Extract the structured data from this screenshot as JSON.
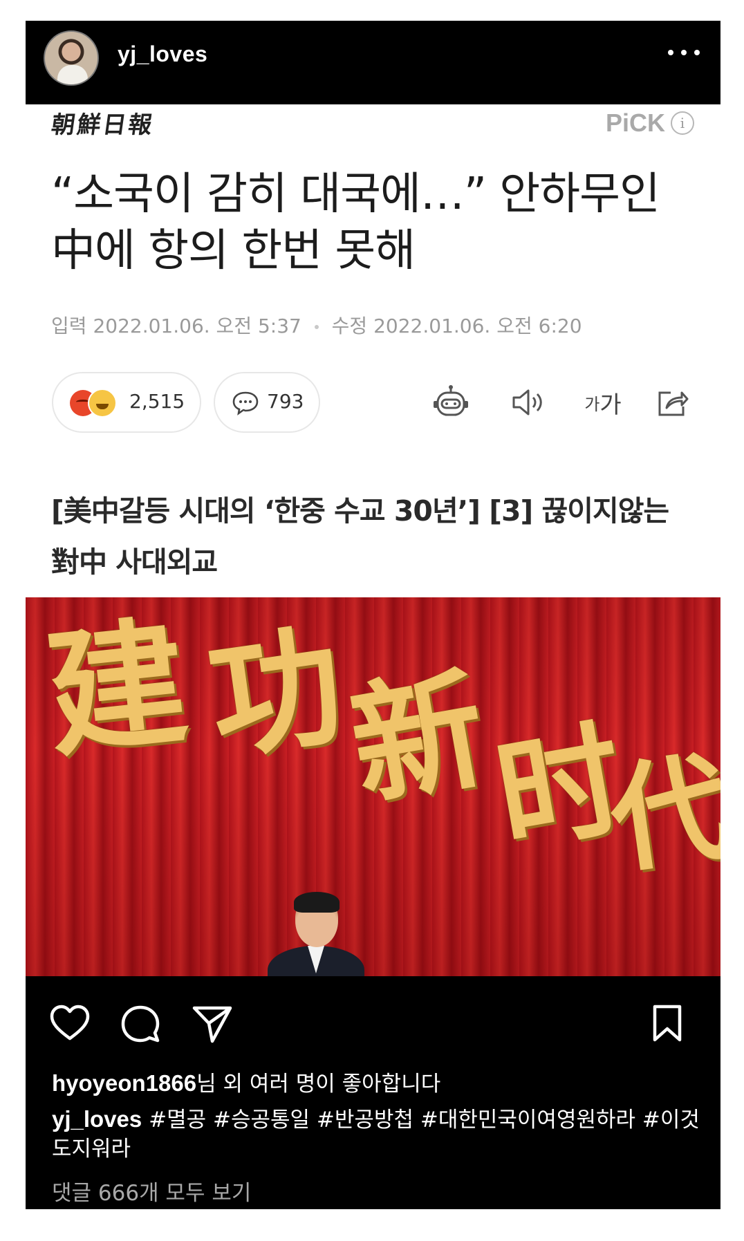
{
  "post": {
    "username": "yj_loves",
    "liked_by_user": "hyoyeon1866",
    "liked_by_suffix": "님 외 여러 명이 좋아합니다",
    "caption_user": "yj_loves",
    "hashtags": [
      "#멸공",
      "#승공통일",
      "#반공방첩",
      "#대한민국이여영원하라",
      "#이것도지워라"
    ],
    "view_comments": "댓글 666개 모두 보기"
  },
  "article": {
    "publisher": "朝鮮日報",
    "pick_label": "PiCK",
    "info_label": "i",
    "headline": "“소국이 감히 대국에…” 안하무인 中에 항의 한번 못해",
    "published_label": "입력",
    "published": "2022.01.06. 오전 5:37",
    "modified_label": "수정",
    "modified": "2022.01.06. 오전 6:20",
    "reaction_count": "2,515",
    "comment_count": "793",
    "font_small": "가",
    "font_large": "가",
    "subheadline": "[美中갈등 시대의 ‘한중 수교 30년’] [3] 끊이지않는 對中 사대외교"
  },
  "photo": {
    "banner_chars": [
      "建",
      "功",
      "新",
      "时",
      "代"
    ]
  },
  "icons": {
    "more": "more-icon",
    "angry": "angry-emoji-icon",
    "laugh": "laugh-emoji-icon",
    "comment_bubble": "comment-bubble-icon",
    "robot": "robot-icon",
    "speaker": "speaker-icon",
    "share": "share-icon",
    "heart": "heart-icon",
    "ig_comment": "comment-icon",
    "send": "send-icon",
    "bookmark": "bookmark-icon"
  },
  "colors": {
    "ig_bar": "#000000",
    "curtain_red": "#c91f24",
    "gold": "#f0c46a",
    "muted_text": "#9a9a9a"
  }
}
